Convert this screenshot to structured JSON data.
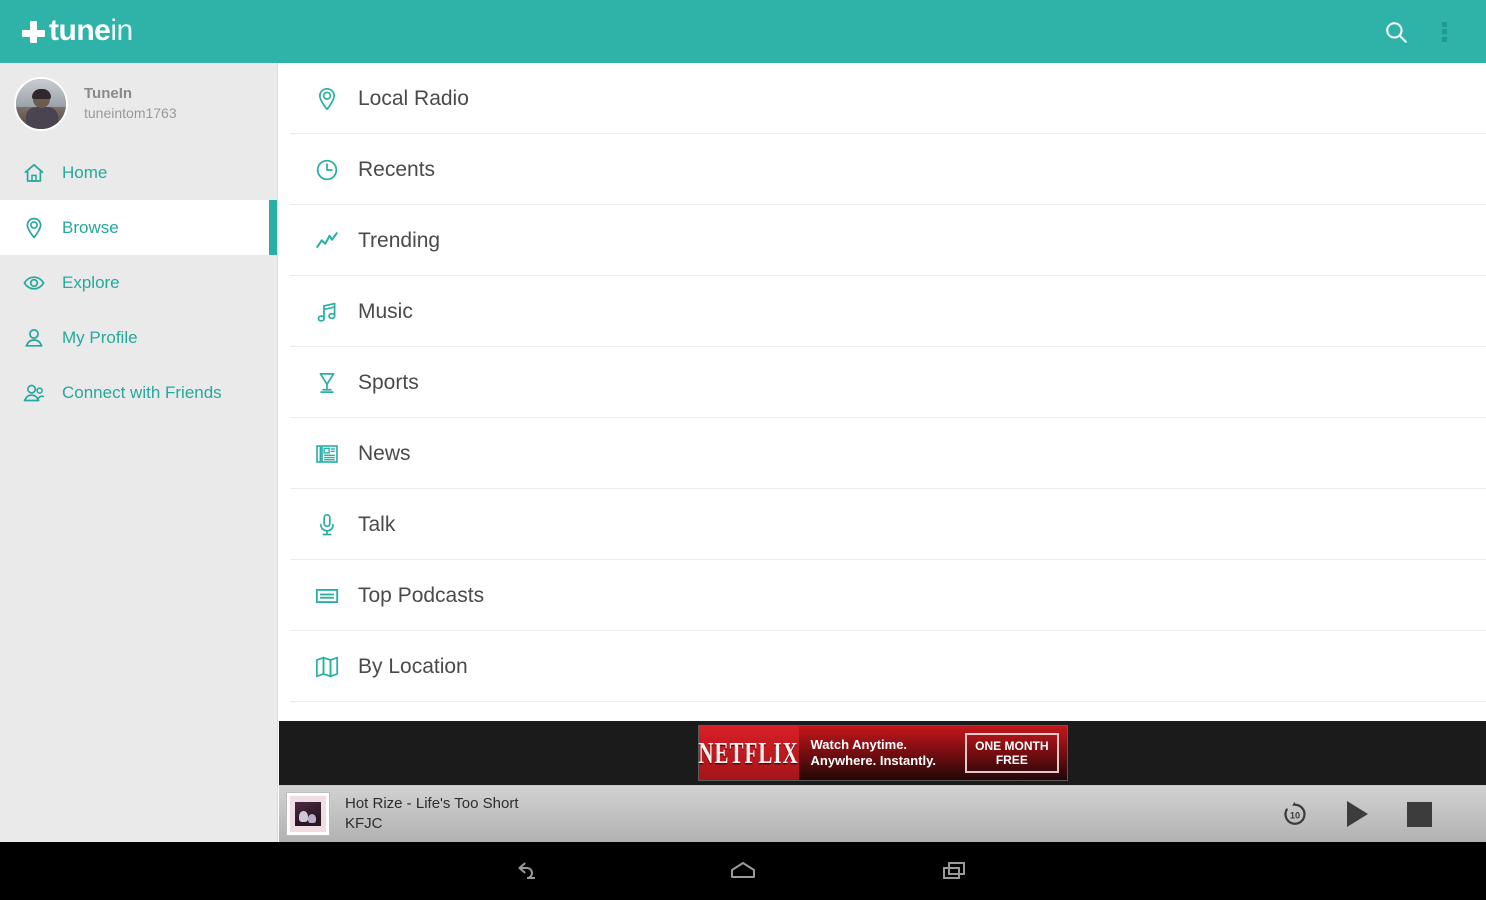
{
  "app": {
    "name": "TuneIn",
    "logo_bold": "tune",
    "logo_light": "in",
    "accent_color": "#2fb3a8",
    "logo_icon": "tunein-logo-icon"
  },
  "appbar": {
    "search_icon": "search-icon",
    "overflow_icon": "overflow-menu-icon"
  },
  "sidebar": {
    "profile": {
      "name": "TuneIn",
      "handle": "tuneintom1763",
      "avatar_icon": "avatar"
    },
    "items": [
      {
        "label": "Home",
        "icon": "home-icon",
        "active": false
      },
      {
        "label": "Browse",
        "icon": "location-pin-icon",
        "active": true
      },
      {
        "label": "Explore",
        "icon": "eye-icon",
        "active": false
      },
      {
        "label": "My Profile",
        "icon": "person-icon",
        "active": false
      },
      {
        "label": "Connect with Friends",
        "icon": "people-icon",
        "active": false
      }
    ]
  },
  "main": {
    "items": [
      {
        "label": "Local Radio",
        "icon": "location-pin-icon"
      },
      {
        "label": "Recents",
        "icon": "clock-icon"
      },
      {
        "label": "Trending",
        "icon": "trending-up-icon"
      },
      {
        "label": "Music",
        "icon": "music-note-icon"
      },
      {
        "label": "Sports",
        "icon": "trophy-icon"
      },
      {
        "label": "News",
        "icon": "newspaper-icon"
      },
      {
        "label": "Talk",
        "icon": "microphone-icon"
      },
      {
        "label": "Top Podcasts",
        "icon": "podcast-card-icon"
      },
      {
        "label": "By Location",
        "icon": "map-icon"
      }
    ]
  },
  "ad": {
    "brand": "NETFLIX",
    "copy_line1": "Watch Anytime.",
    "copy_line2": "Anywhere. Instantly.",
    "cta_line1": "ONE MONTH",
    "cta_line2": "FREE",
    "brand_color": "#d81f26"
  },
  "player": {
    "track_title": "Hot Rize - Life's Too Short",
    "station": "KFJC",
    "album_art_icon": "album-art",
    "rewind_label": "10",
    "rewind_icon": "rewind-10-icon",
    "play_icon": "play-icon",
    "stop_icon": "stop-icon"
  },
  "navbar": {
    "back_icon": "back-icon",
    "home_icon": "home-icon",
    "recents_icon": "recents-icon"
  }
}
